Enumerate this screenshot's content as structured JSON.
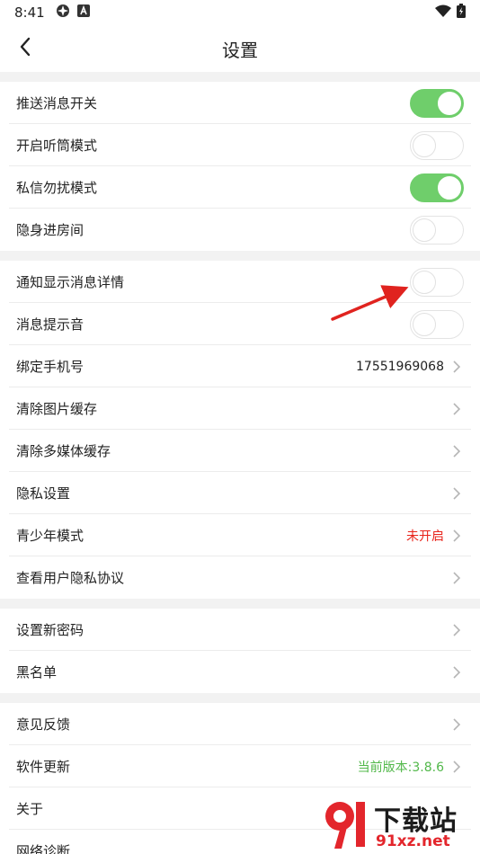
{
  "status_bar": {
    "time": "8:41",
    "icons": [
      "vpn-icon",
      "accessibility-a-icon"
    ],
    "right_icons": [
      "wifi-icon",
      "battery-icon"
    ]
  },
  "header": {
    "title": "设置",
    "back_icon": "chevron-left-icon"
  },
  "groups": [
    {
      "rows": [
        {
          "id": "push",
          "label": "推送消息开关",
          "type": "toggle",
          "on": true
        },
        {
          "id": "earpiece",
          "label": "开启听筒模式",
          "type": "toggle",
          "on": false
        },
        {
          "id": "dnd",
          "label": "私信勿扰模式",
          "type": "toggle",
          "on": true
        },
        {
          "id": "invisible",
          "label": "隐身进房间",
          "type": "toggle",
          "on": false
        }
      ]
    },
    {
      "rows": [
        {
          "id": "notify-detail",
          "label": "通知显示消息详情",
          "type": "toggle",
          "on": false
        },
        {
          "id": "msg-sound",
          "label": "消息提示音",
          "type": "toggle",
          "on": false
        },
        {
          "id": "bind-phone",
          "label": "绑定手机号",
          "type": "link",
          "value": "17551969068",
          "value_color": "normal"
        },
        {
          "id": "clear-image",
          "label": "清除图片缓存",
          "type": "link",
          "value": ""
        },
        {
          "id": "clear-media",
          "label": "清除多媒体缓存",
          "type": "link",
          "value": ""
        },
        {
          "id": "privacy",
          "label": "隐私设置",
          "type": "link",
          "value": ""
        },
        {
          "id": "teen-mode",
          "label": "青少年模式",
          "type": "link",
          "value": "未开启",
          "value_color": "red"
        },
        {
          "id": "privacy-policy",
          "label": "查看用户隐私协议",
          "type": "link",
          "value": ""
        }
      ]
    },
    {
      "rows": [
        {
          "id": "new-password",
          "label": "设置新密码",
          "type": "link",
          "value": ""
        },
        {
          "id": "blacklist",
          "label": "黑名单",
          "type": "link",
          "value": ""
        }
      ]
    },
    {
      "rows": [
        {
          "id": "feedback",
          "label": "意见反馈",
          "type": "link",
          "value": ""
        },
        {
          "id": "update",
          "label": "软件更新",
          "type": "link",
          "value": "当前版本:3.8.6",
          "value_color": "green"
        },
        {
          "id": "about",
          "label": "关于",
          "type": "link",
          "value": ""
        },
        {
          "id": "network",
          "label": "网络诊断",
          "type": "link",
          "value": ""
        }
      ]
    }
  ],
  "colors": {
    "toggle_on": "#6fce6b",
    "red_value": "#e8231a",
    "green_value": "#52b84a",
    "annotation_arrow": "#e0231f"
  },
  "watermark": {
    "big_text": "下载站",
    "small_text": "91xz.net"
  }
}
